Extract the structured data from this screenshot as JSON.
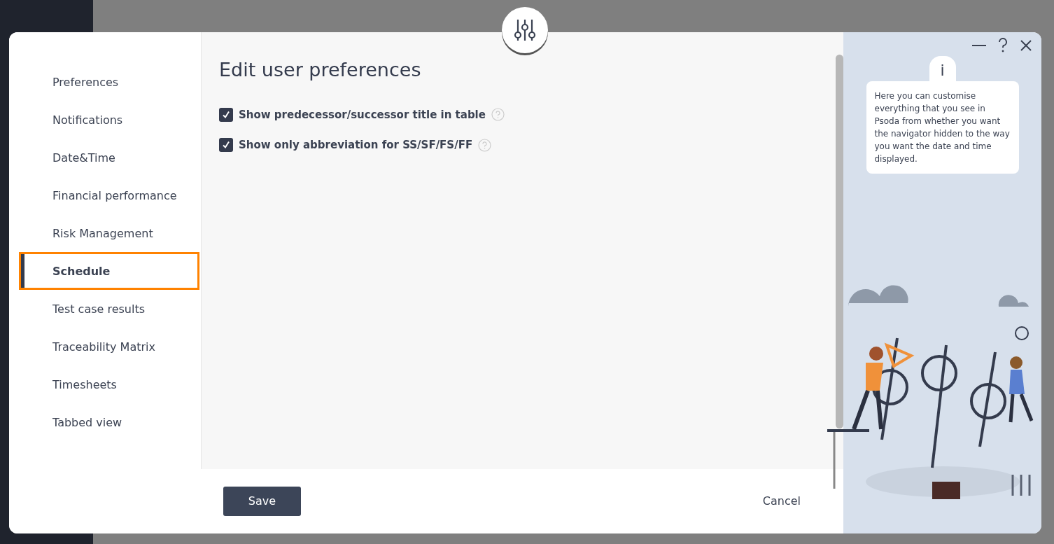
{
  "dialog": {
    "title": "Edit user preferences"
  },
  "menu": [
    {
      "label": "Preferences",
      "selected": false
    },
    {
      "label": "Notifications",
      "selected": false
    },
    {
      "label": "Date&Time",
      "selected": false
    },
    {
      "label": "Financial performance",
      "selected": false
    },
    {
      "label": "Risk Management",
      "selected": false
    },
    {
      "label": "Schedule",
      "selected": true
    },
    {
      "label": "Test case results",
      "selected": false
    },
    {
      "label": "Traceability Matrix",
      "selected": false
    },
    {
      "label": "Timesheets",
      "selected": false
    },
    {
      "label": "Tabbed view",
      "selected": false
    }
  ],
  "options": [
    {
      "label": "Show predecessor/successor title in table",
      "checked": true
    },
    {
      "label": "Show only abbreviation for SS/SF/FS/FF",
      "checked": true
    }
  ],
  "footer": {
    "save": "Save",
    "cancel": "Cancel"
  },
  "help": {
    "badge": "i",
    "text": "Here you can customise everything that you see in Psoda from whether you want the navigator hidden to the way you want the date and time displayed."
  }
}
